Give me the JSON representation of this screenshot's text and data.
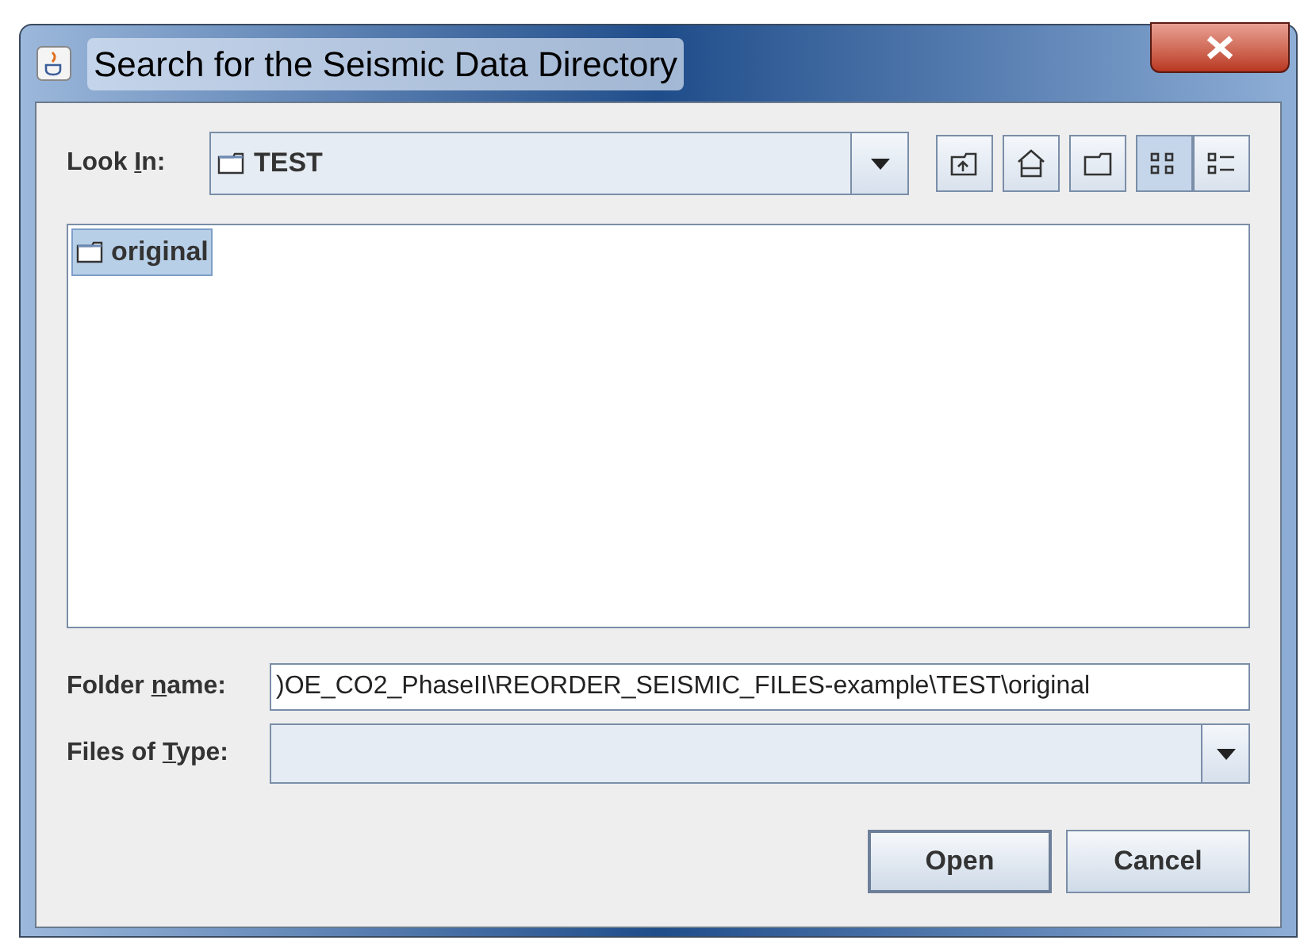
{
  "window": {
    "title": "Search for the Seismic Data Directory"
  },
  "look_in": {
    "label": {
      "before": "Look ",
      "key": "I",
      "after": "n:"
    },
    "value": "TEST"
  },
  "toolbar": [
    {
      "kind": "up",
      "selected": false
    },
    {
      "kind": "home",
      "selected": false
    },
    {
      "kind": "new-folder",
      "selected": false
    },
    {
      "kind": "list",
      "selected": true
    },
    {
      "kind": "details",
      "selected": false
    }
  ],
  "files": [
    {
      "name": "original",
      "selected": true
    }
  ],
  "folder_name": {
    "label": {
      "before": "Folder ",
      "key": "n",
      "after": "ame:"
    },
    "value": ")OE_CO2_PhaseII\\REORDER_SEISMIC_FILES-example\\TEST\\original"
  },
  "files_of_type": {
    "label": {
      "before": "Files of ",
      "key": "T",
      "after": "ype:"
    }
  },
  "buttons": [
    {
      "label": "Open",
      "default": true
    },
    {
      "label": "Cancel",
      "default": false
    }
  ]
}
